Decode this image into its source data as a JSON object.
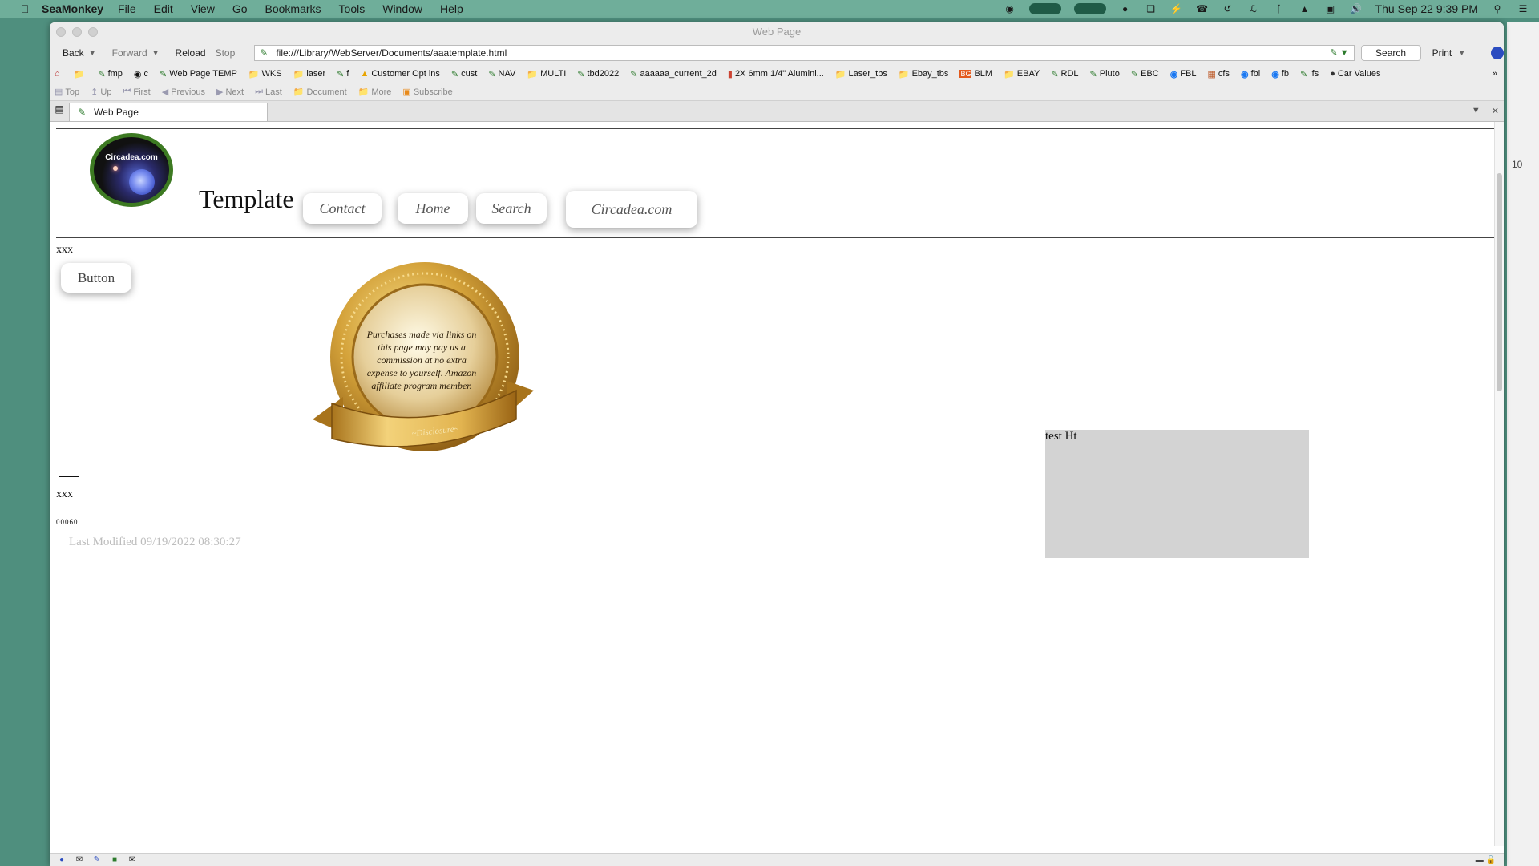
{
  "menubar": {
    "app_name": "SeaMonkey",
    "items": [
      "File",
      "Edit",
      "View",
      "Go",
      "Bookmarks",
      "Tools",
      "Window",
      "Help"
    ],
    "datetime": "Thu Sep 22  9:39 PM"
  },
  "window": {
    "title": "Web Page"
  },
  "navbar": {
    "back": "Back",
    "forward": "Forward",
    "reload": "Reload",
    "stop": "Stop",
    "url": "file:///Library/WebServer/Documents/aaatemplate.html",
    "search": "Search",
    "print": "Print"
  },
  "bookmarks": [
    {
      "label": "fmp",
      "icon": "page-icon"
    },
    {
      "label": "c",
      "icon": "link-icon"
    },
    {
      "label": "Web Page TEMP",
      "icon": "page-icon"
    },
    {
      "label": "WKS",
      "icon": "folder-icon"
    },
    {
      "label": "laser",
      "icon": "folder-icon"
    },
    {
      "label": "f",
      "icon": "page-icon"
    },
    {
      "label": "Customer Opt ins",
      "icon": "drive-icon"
    },
    {
      "label": "cust",
      "icon": "page-icon"
    },
    {
      "label": "NAV",
      "icon": "page-icon"
    },
    {
      "label": "MULTI",
      "icon": "folder-icon"
    },
    {
      "label": "tbd2022",
      "icon": "page-icon"
    },
    {
      "label": "aaaaaa_current_2d",
      "icon": "page-icon"
    },
    {
      "label": "2X 6mm 1/4\" Alumini...",
      "icon": "product-icon"
    },
    {
      "label": "Laser_tbs",
      "icon": "folder-icon"
    },
    {
      "label": "Ebay_tbs",
      "icon": "folder-icon"
    },
    {
      "label": "BLM",
      "icon": "bg-icon"
    },
    {
      "label": "EBAY",
      "icon": "folder-icon"
    },
    {
      "label": "RDL",
      "icon": "page-icon"
    },
    {
      "label": "Pluto",
      "icon": "page-icon"
    },
    {
      "label": "EBC",
      "icon": "page-icon"
    },
    {
      "label": "FBL",
      "icon": "facebook-icon"
    },
    {
      "label": "cfs",
      "icon": "bars-icon"
    },
    {
      "label": "fbl",
      "icon": "facebook-icon"
    },
    {
      "label": "fb",
      "icon": "facebook-icon"
    },
    {
      "label": "lfs",
      "icon": "page-icon"
    },
    {
      "label": "Car Values",
      "icon": "mic-icon"
    }
  ],
  "sitenav": [
    "Top",
    "Up",
    "First",
    "Previous",
    "Next",
    "Last",
    "Document",
    "More",
    "Subscribe"
  ],
  "tab": {
    "label": "Web Page"
  },
  "page": {
    "logo_text": "Circadea.com",
    "title": "Template",
    "nav": [
      "Contact",
      "Home",
      "Search",
      "Circadea.com"
    ],
    "xxx_top": "xxx",
    "button_label": "Button",
    "badge_text": "Purchases made via links on this page may pay us a commission at no extra expense to yourself. Amazon affiliate program member.",
    "badge_ribbon": "~Disclosure~",
    "box_text": "test Ht",
    "xxx_bottom": "xxx",
    "small_code": "00060",
    "last_modified": "Last Modified  09/19/2022 08:30:27"
  },
  "colors": {
    "desktop": "#4f8f7e",
    "menubar": "#6fae9a",
    "gray_box": "#d3d3d3",
    "logo_ring": "#3d7a22",
    "gold": "#c9962a"
  }
}
